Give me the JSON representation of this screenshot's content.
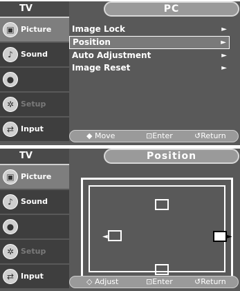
{
  "panel1": {
    "tab_left": "TV",
    "tab_right": "PC",
    "sidebar": [
      {
        "label": "Picture",
        "icon": "picture-icon"
      },
      {
        "label": "Sound",
        "icon": "sound-icon"
      },
      {
        "label": "",
        "icon": "channel-icon"
      },
      {
        "label": "Setup",
        "icon": "setup-icon"
      },
      {
        "label": "Input",
        "icon": "input-icon"
      }
    ],
    "menu": [
      {
        "label": "Image Lock",
        "arrow": "►"
      },
      {
        "label": "Position",
        "arrow": "►"
      },
      {
        "label": "Auto Adjustment",
        "arrow": "►"
      },
      {
        "label": "Image Reset",
        "arrow": "►"
      }
    ],
    "footer": {
      "move": "◆ Move",
      "enter": "⊡Enter",
      "return": "↺Return"
    }
  },
  "panel2": {
    "tab_left": "TV",
    "tab_right": "Position",
    "sidebar": [
      {
        "label": "Picture",
        "icon": "picture-icon"
      },
      {
        "label": "Sound",
        "icon": "sound-icon"
      },
      {
        "label": "",
        "icon": "channel-icon"
      },
      {
        "label": "Setup",
        "icon": "setup-icon"
      },
      {
        "label": "Input",
        "icon": "input-icon"
      }
    ],
    "footer": {
      "adjust": "◇ Adjust",
      "enter": "⊡Enter",
      "return": "↺Return"
    }
  }
}
